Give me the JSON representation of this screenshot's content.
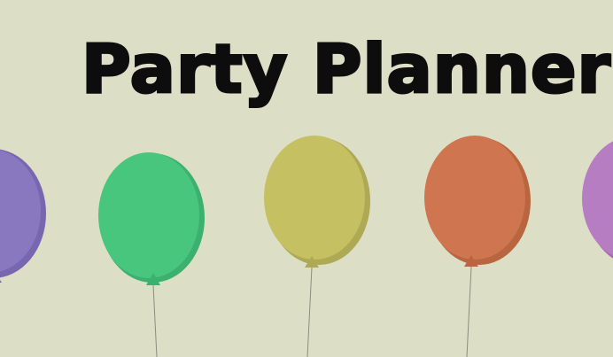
{
  "title": "Party Planner",
  "colors": {
    "background": "#dcdfc6",
    "title": "#0d0d0d",
    "string": "#8c8c80"
  },
  "balloons": [
    {
      "name": "purple",
      "color": "#8978c0",
      "shade": "#7867b0"
    },
    {
      "name": "green",
      "color": "#48c67e",
      "shade": "#3cb16f"
    },
    {
      "name": "yellow",
      "color": "#c5c062",
      "shade": "#aea954"
    },
    {
      "name": "orange",
      "color": "#cf754f",
      "shade": "#b9653f"
    },
    {
      "name": "pink",
      "color": "#b77dc3",
      "shade": "#a36cb1"
    }
  ]
}
